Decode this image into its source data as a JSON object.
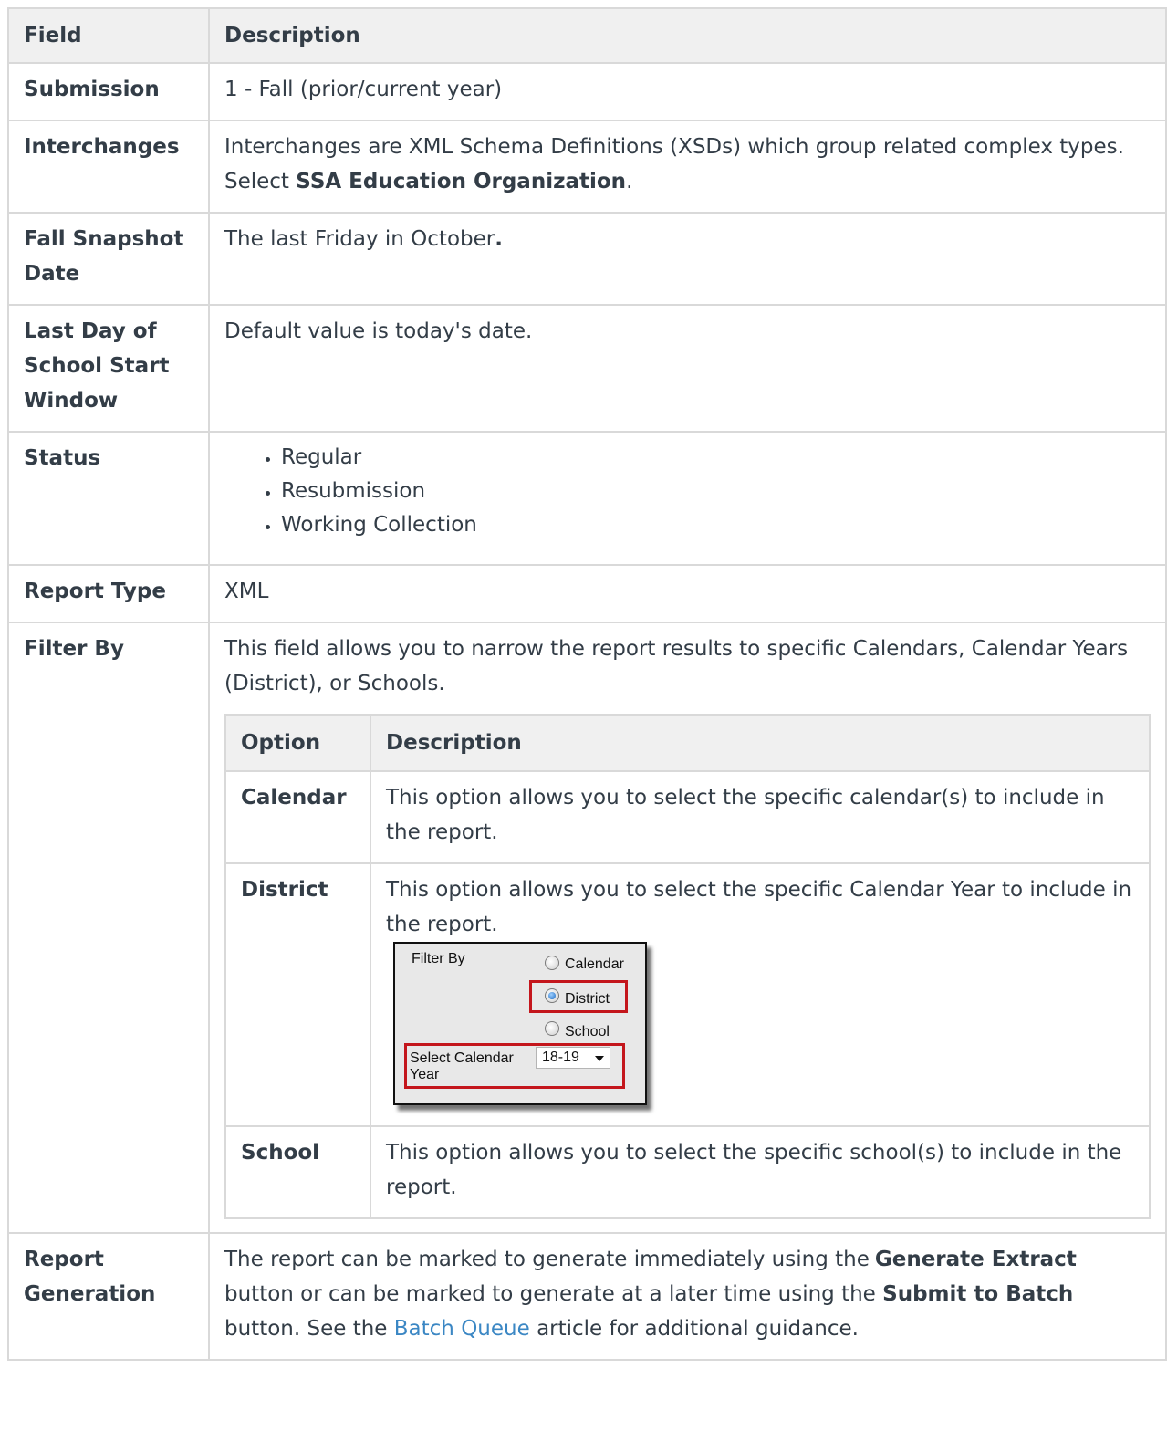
{
  "header": {
    "field": "Field",
    "description": "Description"
  },
  "rows": {
    "submission": {
      "field": "Submission",
      "description": "1 - Fall (prior/current year)"
    },
    "interchanges": {
      "field": "Interchanges",
      "description": "Interchanges are XML Schema Definitions (XSDs) which group related complex types.",
      "select_prefix": "Select",
      "select_value": "SSA Education Organization",
      "select_suffix": "."
    },
    "fall_snapshot": {
      "field": "Fall Snapshot Date",
      "description": "The last Friday in October",
      "description_suffix": "."
    },
    "last_day": {
      "field": "Last Day of School Start Window",
      "description": "Default value is today's date."
    },
    "status": {
      "field": "Status",
      "options": [
        "Regular",
        "Resubmission",
        "Working Collection"
      ]
    },
    "report_type": {
      "field": "Report Type",
      "description": "XML"
    },
    "filter_by": {
      "field": "Filter By",
      "description": "This field allows you to narrow the report results to specific Calendars, Calendar Years (District), or Schools.",
      "inner_header": {
        "option": "Option",
        "description": "Description"
      },
      "options": [
        {
          "option": "Calendar",
          "description": "This option allows you to select the specific calendar(s) to include in the report."
        },
        {
          "option": "District",
          "description": "This option allows you to select the specific Calendar Year to include in the report."
        },
        {
          "option": "School",
          "description": "This option allows you to select the specific school(s) to include in the report."
        }
      ],
      "screenshot": {
        "filter_by_label": "Filter By",
        "radio_calendar": "Calendar",
        "radio_district": "District",
        "radio_school": "School",
        "selected_radio": "District",
        "select_calendar_year_label": "Select Calendar Year",
        "select_calendar_year_value": "18-19",
        "highlight_color": "#c4161c"
      }
    },
    "report_generation": {
      "field": "Report Generation",
      "text_1": "The report can be marked to generate immediately using the",
      "bold_1": "Generate Extract",
      "text_2": "button or can be marked to generate at a later time using the",
      "bold_2": "Submit to Batch",
      "text_3": "button. See the",
      "link_text": "Batch Queue",
      "text_4": "article for additional guidance."
    }
  },
  "colors": {
    "text": "#333d47",
    "header_bg": "#f0f0f0",
    "border": "#d9d9d9",
    "link": "#3b87c4"
  }
}
